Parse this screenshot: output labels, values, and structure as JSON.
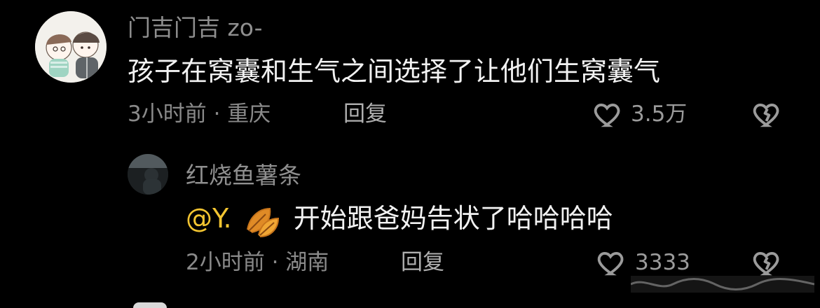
{
  "comments": [
    {
      "username": "门吉门吉 zo-",
      "text": "孩子在窝囊和生气之间选择了让他们生窝囊气",
      "time_location": "3小时前 · 重庆",
      "reply_label": "回复",
      "like_count": "3.5万"
    },
    {
      "username": "红烧鱼薯条",
      "mention": "@Y.",
      "text": "开始跟爸妈告状了哈哈哈哈",
      "time_location": "2小时前 · 湖南",
      "reply_label": "回复",
      "like_count": "3333"
    }
  ],
  "colors": {
    "background": "#000000",
    "text": "#f2f2f2",
    "secondary": "#8a8a8a",
    "mention": "#f3c531"
  },
  "icons": [
    "avatar",
    "heart-icon",
    "broken-heart-icon",
    "leaf-icon"
  ]
}
